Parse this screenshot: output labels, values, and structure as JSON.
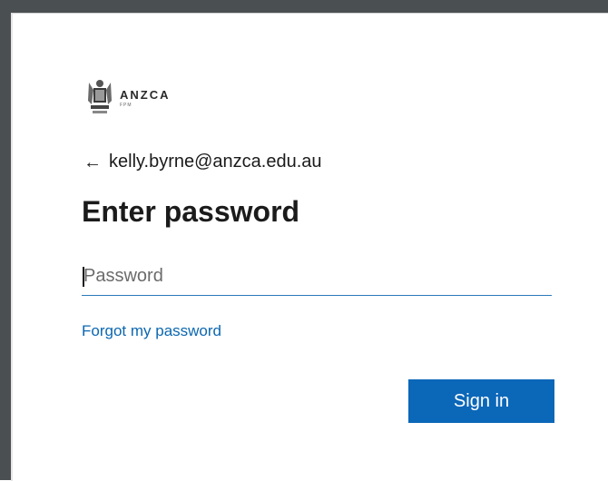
{
  "brand": {
    "name": "ANZCA",
    "sub": "FPM",
    "crest_icon": "coat-of-arms-icon"
  },
  "account": {
    "back_icon": "arrow-left-icon",
    "email": "kelly.byrne@anzca.edu.au"
  },
  "form": {
    "title": "Enter password",
    "password_placeholder": "Password",
    "password_value": "",
    "forgot_link": "Forgot my password",
    "submit_label": "Sign in"
  },
  "colors": {
    "accent": "#0b67b8",
    "link": "#0b67b1",
    "frame": "#4a4f51"
  }
}
